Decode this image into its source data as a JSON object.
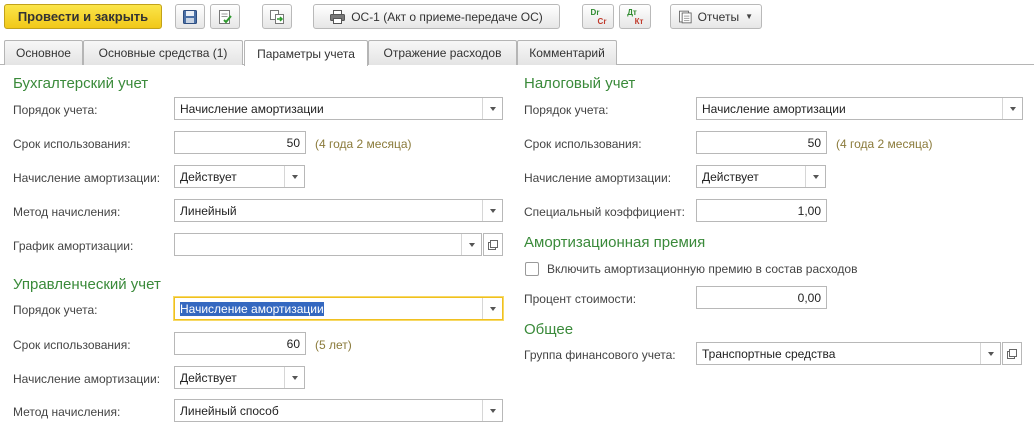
{
  "toolbar": {
    "post_close_label": "Провести и закрыть",
    "print_label": "ОС-1 (Акт о приеме-передаче ОС)",
    "dr_label": "Dr",
    "cr_label": "Cr",
    "dt_label": "Дт",
    "kt_label": "Кт",
    "reports_label": "Отчеты"
  },
  "tabs": [
    {
      "label": "Основное"
    },
    {
      "label": "Основные средства (1)"
    },
    {
      "label": "Параметры учета"
    },
    {
      "label": "Отражение расходов"
    },
    {
      "label": "Комментарий"
    }
  ],
  "accounting": {
    "title": "Бухгалтерский учет",
    "order_label": "Порядок учета:",
    "order_value": "Начисление амортизации",
    "term_label": "Срок использования:",
    "term_value": "50",
    "term_hint": "(4 года 2 месяца)",
    "depr_label": "Начисление амортизации:",
    "depr_value": "Действует",
    "method_label": "Метод начисления:",
    "method_value": "Линейный",
    "schedule_label": "График амортизации:",
    "schedule_value": ""
  },
  "management": {
    "title": "Управленческий учет",
    "order_label": "Порядок учета:",
    "order_value": "Начисление амортизации",
    "term_label": "Срок использования:",
    "term_value": "60",
    "term_hint": "(5 лет)",
    "depr_label": "Начисление амортизации:",
    "depr_value": "Действует",
    "method_label": "Метод начисления:",
    "method_value": "Линейный способ"
  },
  "tax": {
    "title": "Налоговый учет",
    "order_label": "Порядок учета:",
    "order_value": "Начисление амортизации",
    "term_label": "Срок использования:",
    "term_value": "50",
    "term_hint": "(4 года 2 месяца)",
    "depr_label": "Начисление амортизации:",
    "depr_value": "Действует",
    "coef_label": "Специальный коэффициент:",
    "coef_value": "1,00"
  },
  "bonus": {
    "title": "Амортизационная премия",
    "include_label": "Включить амортизационную премию в состав расходов",
    "include_checked": false,
    "percent_label": "Процент стоимости:",
    "percent_value": "0,00"
  },
  "general": {
    "title": "Общее",
    "group_label": "Группа финансового учета:",
    "group_value": "Транспортные средства"
  },
  "colors": {
    "accent_green": "#3a8a3a",
    "primary_yellow": "#f1c818",
    "selection_blue": "#3468c0",
    "hint_olive": "#8a7a3a"
  }
}
